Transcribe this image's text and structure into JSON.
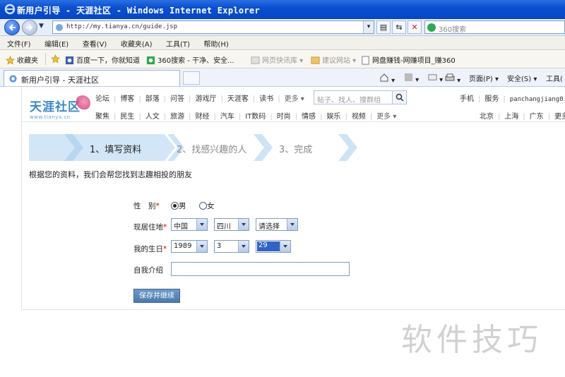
{
  "window": {
    "title": "新用户引导 - 天涯社区 - Windows Internet Explorer"
  },
  "address": {
    "url": "http://my.tianya.cn/guide.jsp",
    "search_placeholder": "360搜索"
  },
  "menu": [
    "文件(F)",
    "编辑(E)",
    "查看(V)",
    "收藏夹(A)",
    "工具(T)",
    "帮助(H)"
  ],
  "favorites": {
    "favorites_label": "收藏夹",
    "items": [
      "百度一下，你就知道",
      "360搜索 - 干净、安全...",
      "网页快讯库 ▾",
      "建议网站 ▾",
      "网盘赚钱-网赚项目_赚360"
    ]
  },
  "tab": {
    "title": "新用户引导 - 天涯社区"
  },
  "commands": {
    "page": "页面(P) ▾",
    "safety": "安全(S) ▾",
    "tools": "工具("
  },
  "site": {
    "logo_text": "天涯社区",
    "logo_url": "www.tianya.cn",
    "nav_top": [
      "论坛",
      "博客",
      "部落",
      "问答",
      "游戏厅",
      "天涯客",
      "读书",
      "更多 ▾"
    ],
    "nav_bottom": [
      "聚焦",
      "民生",
      "人文",
      "旅游",
      "财经",
      "汽车",
      "IT数码",
      "时尚",
      "情感",
      "娱乐",
      "视频",
      "更多 ▾"
    ],
    "search_placeholder": "帖子、找人、搜群组",
    "user_links": [
      "手机",
      "服务",
      "panchangjiang0"
    ],
    "regions": [
      "北京",
      "上海",
      "广东",
      "更多"
    ]
  },
  "steps": [
    "1、填写资料",
    "2、找感兴趣的人",
    "3、完成"
  ],
  "intro": "根据您的资料，我们会帮您找到志趣相投的朋友",
  "form": {
    "gender_label": "性　别",
    "gender_options": [
      "男",
      "女"
    ],
    "gender_selected": "男",
    "location_label": "现居住地",
    "country": "中国",
    "province": "四川",
    "city": "请选择",
    "birthday_label": "我的生日",
    "year": "1989",
    "month": "3",
    "day": "29",
    "about_label": "自我介绍",
    "about_value": "",
    "required_mark": "*",
    "save_label": "保存并继续"
  },
  "watermark": "软件技巧",
  "colors": {
    "ie_blue": "#0a4fd0",
    "step_active": "#d3e6f7",
    "button": "#4a79ac"
  }
}
